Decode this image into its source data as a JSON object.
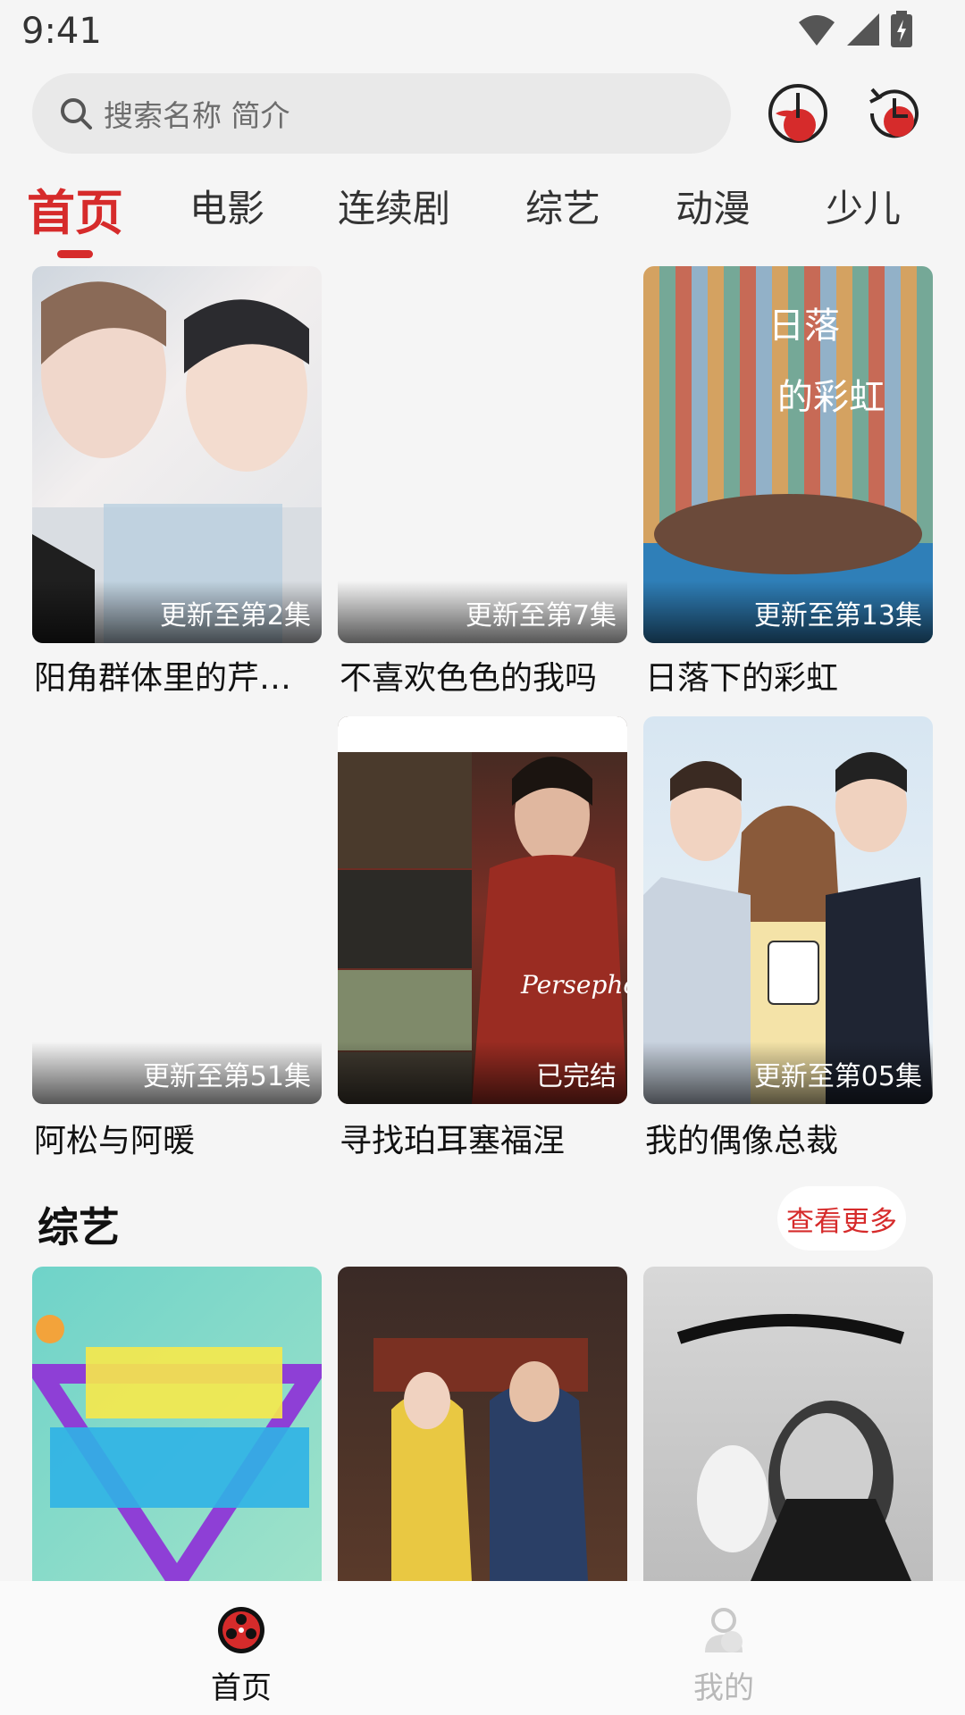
{
  "status_bar": {
    "time": "9:41"
  },
  "search": {
    "placeholder": "搜索名称 简介"
  },
  "tabs": [
    {
      "label": "首页",
      "active": true
    },
    {
      "label": "电影"
    },
    {
      "label": "连续剧"
    },
    {
      "label": "综艺"
    },
    {
      "label": "动漫"
    },
    {
      "label": "少儿"
    }
  ],
  "cards": [
    {
      "title": "阳角群体里的芹…",
      "badge": "更新至第2集"
    },
    {
      "title": "不喜欢色色的我吗",
      "badge": "更新至第7集"
    },
    {
      "title": "日落下的彩虹",
      "badge": "更新至第13集"
    },
    {
      "title": "阿松与阿暖",
      "badge": "更新至第51集"
    },
    {
      "title": "寻找珀耳塞福涅",
      "badge": "已完结"
    },
    {
      "title": "我的偶像总裁",
      "badge": "更新至第05集"
    }
  ],
  "variety_section": {
    "title": "综艺",
    "more_label": "查看更多"
  },
  "bottom_nav": {
    "home_label": "首页",
    "mine_label": "我的"
  },
  "colors": {
    "accent": "#d62b2b"
  }
}
